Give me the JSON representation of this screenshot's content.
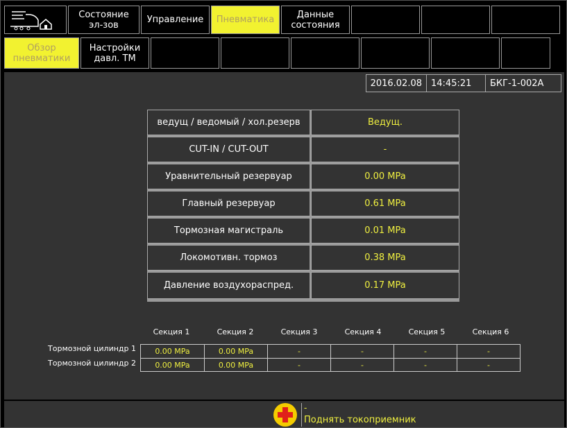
{
  "nav_top": [
    {
      "label": "Состояние\nэл-зов",
      "width": 90
    },
    {
      "label": "Управление",
      "width": 103
    },
    {
      "label": "Пневматика",
      "width": 99,
      "active": true
    },
    {
      "label": "Данные\nсостояния",
      "width": 99
    },
    {
      "label": "",
      "width": 99
    },
    {
      "label": "",
      "width": 99
    },
    {
      "label": "",
      "width": 99
    },
    {
      "label": "",
      "width": 99
    }
  ],
  "nav_sub": [
    {
      "label": "Обзор\nпневматики",
      "active": true
    },
    {
      "label": "Настройки\nдавл. ТМ"
    },
    {
      "label": ""
    },
    {
      "label": ""
    },
    {
      "label": ""
    },
    {
      "label": ""
    },
    {
      "label": ""
    },
    {
      "label": ""
    }
  ],
  "info": {
    "date": "2016.02.08",
    "time": "14:45:21",
    "unit_id": "БКГ-1-002А"
  },
  "params": [
    {
      "label": "ведущ / ведомый / хол.резерв",
      "value": "Ведущ."
    },
    {
      "label": "CUT-IN / CUT-OUT",
      "value": "-"
    },
    {
      "label": "Уравнительный резервуар",
      "value": "0.00 MPa"
    },
    {
      "label": "Главный резервуар",
      "value": "0.61 MPa"
    },
    {
      "label": "Тормозная магистраль",
      "value": "0.01 MPa"
    },
    {
      "label": "Локомотивн. тормоз",
      "value": "0.38 MPa"
    },
    {
      "label": "Давление воздухораспред.",
      "value": "0.17 MPa"
    }
  ],
  "sections": [
    "Секция 1",
    "Секция 2",
    "Секция 3",
    "Секция 4",
    "Секция 5",
    "Секция 6"
  ],
  "cylinders": [
    {
      "label": "Тормозной цилиндр 1",
      "values": [
        "0.00 MPa",
        "0.00 MPa",
        "-",
        "-",
        "-",
        "-"
      ]
    },
    {
      "label": "Тормозной цилиндр 2",
      "values": [
        "0.00 MPa",
        "0.00 MPa",
        "-",
        "-",
        "-",
        "-"
      ]
    }
  ],
  "alarm": {
    "icon": "red-cross-alarm-icon",
    "code": "-",
    "message": "Поднять токоприемник"
  },
  "colors": {
    "active_tab": "#f2f230",
    "value_yellow": "#f0f040",
    "panel_bg": "#333333"
  }
}
